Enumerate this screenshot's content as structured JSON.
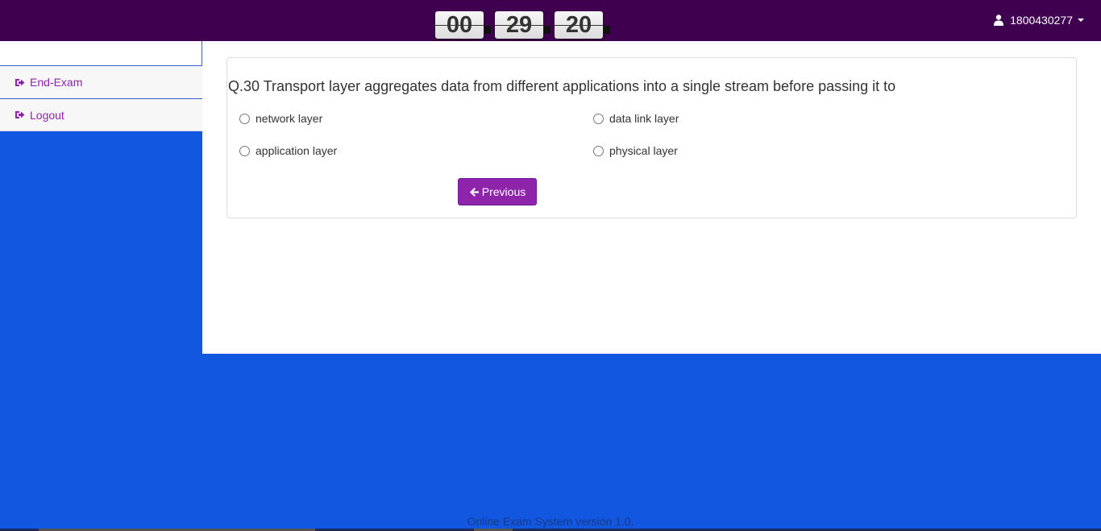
{
  "header": {
    "timer": {
      "hours": "00",
      "minutes": "29",
      "seconds": "20"
    },
    "user": {
      "id": "1800430277",
      "icon": "user-icon"
    }
  },
  "sidebar": {
    "items": [
      {
        "label": "End-Exam",
        "icon": "sign-out-icon"
      },
      {
        "label": "Logout",
        "icon": "sign-out-icon"
      }
    ]
  },
  "question": {
    "text": "Q.30 Transport layer aggregates data from different applications into a single stream before passing it to",
    "options": [
      "network layer",
      "data link layer",
      "application layer",
      "physical layer"
    ]
  },
  "buttons": {
    "previous_label": "Previous"
  },
  "footer": {
    "text": "Online Exam System version 1.0."
  },
  "colors": {
    "navbar": "#3f004f",
    "accent": "#8e24aa",
    "background": "#1257e0"
  }
}
